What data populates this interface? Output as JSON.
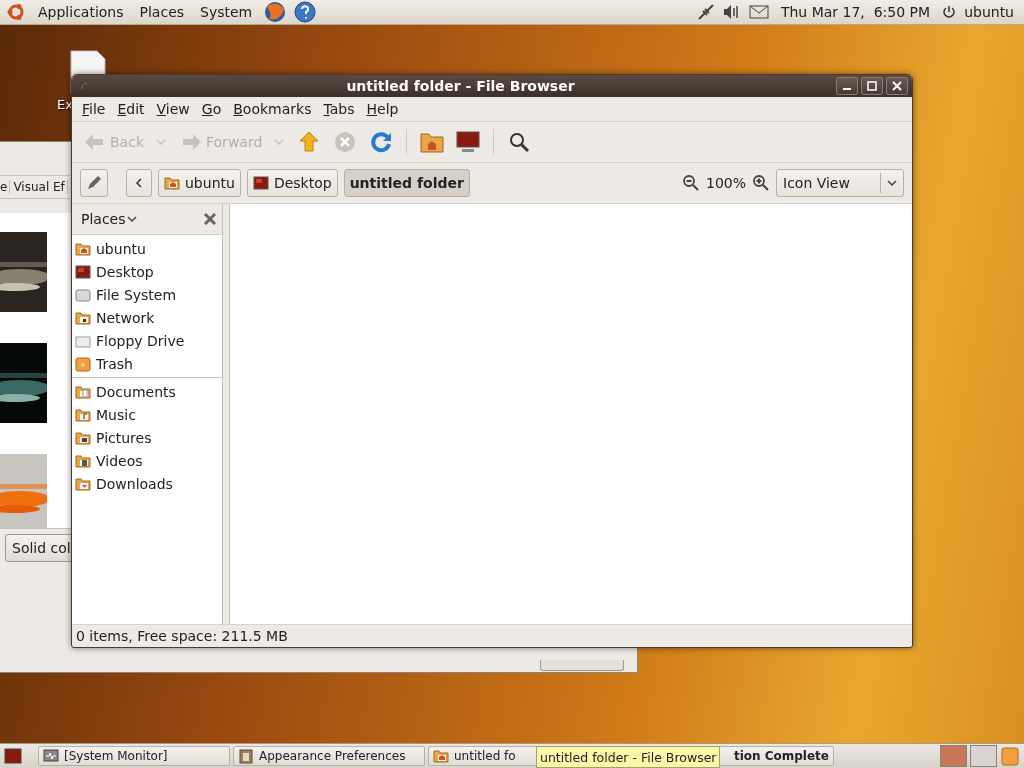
{
  "top_panel": {
    "menus": [
      "Applications",
      "Places",
      "System"
    ],
    "clock": "Thu Mar 17,  6:50 PM",
    "user": "ubuntu"
  },
  "desktop_icon": {
    "label": "Ex"
  },
  "background_window": {
    "tabs": [
      "e",
      "Visual Ef"
    ],
    "button": "Solid col"
  },
  "file_browser": {
    "title": "untitled folder - File Browser",
    "menus": [
      "File",
      "Edit",
      "View",
      "Go",
      "Bookmarks",
      "Tabs",
      "Help"
    ],
    "toolbar": [
      {
        "kind": "back",
        "label": "Back",
        "disabled": true
      },
      {
        "kind": "forward",
        "label": "Forward",
        "disabled": true
      },
      {
        "kind": "up",
        "disabled": false
      },
      {
        "kind": "stop",
        "disabled": true
      },
      {
        "kind": "reload",
        "disabled": false
      },
      {
        "kind": "home",
        "disabled": false
      },
      {
        "kind": "computer",
        "disabled": false
      },
      {
        "kind": "search",
        "disabled": false
      }
    ],
    "path": [
      {
        "label": "ubuntu",
        "kind": "home",
        "selected": false
      },
      {
        "label": "Desktop",
        "kind": "desktop",
        "selected": false
      },
      {
        "label": "untitled folder",
        "kind": "folder",
        "selected": true
      }
    ],
    "zoom": "100%",
    "view": "Icon View",
    "sidebar": {
      "title": "Places",
      "groups": [
        [
          {
            "label": "ubuntu",
            "kind": "home"
          },
          {
            "label": "Desktop",
            "kind": "desktop"
          },
          {
            "label": "File System",
            "kind": "drive"
          },
          {
            "label": "Network",
            "kind": "network"
          },
          {
            "label": "Floppy Drive",
            "kind": "floppy"
          },
          {
            "label": "Trash",
            "kind": "trash"
          }
        ],
        [
          {
            "label": "Documents",
            "kind": "documents"
          },
          {
            "label": "Music",
            "kind": "music"
          },
          {
            "label": "Pictures",
            "kind": "pictures"
          },
          {
            "label": "Videos",
            "kind": "videos"
          },
          {
            "label": "Downloads",
            "kind": "downloads"
          }
        ]
      ]
    },
    "status": "0 items, Free space: 211.5 MB"
  },
  "taskbar": {
    "items": [
      {
        "label": "[System Monitor]",
        "kind": "monitor",
        "urgent": false
      },
      {
        "label": "Appearance Preferences",
        "kind": "preferences",
        "urgent": false
      },
      {
        "label": "untitled fo",
        "kind": "folder",
        "urgent": false
      },
      {
        "label": "tion Complete",
        "kind": "none",
        "urgent": true
      }
    ],
    "tooltip": "untitled folder - File Browser"
  }
}
